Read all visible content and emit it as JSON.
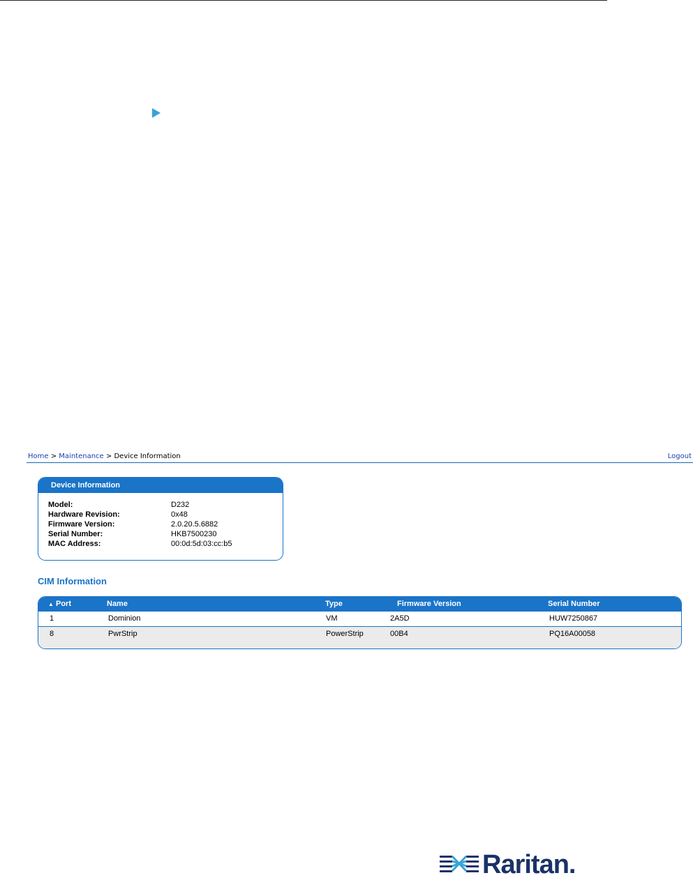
{
  "breadcrumb": {
    "home": "Home",
    "separator": ">",
    "maintenance": "Maintenance",
    "current": "Device Information"
  },
  "logout": "Logout",
  "device_info": {
    "title": "Device Information",
    "rows": [
      {
        "label": "Model:",
        "value": "D232"
      },
      {
        "label": "Hardware Revision:",
        "value": "0x48"
      },
      {
        "label": "Firmware Version:",
        "value": "2.0.20.5.6882"
      },
      {
        "label": "Serial Number:",
        "value": "HKB7500230"
      },
      {
        "label": "MAC Address:",
        "value": "00:0d:5d:03:cc:b5"
      }
    ]
  },
  "cim": {
    "title": "CIM Information",
    "sort_indicator": "▲",
    "columns": [
      "Port",
      "Name",
      "Type",
      "Firmware Version",
      "Serial Number"
    ],
    "rows": [
      [
        "1",
        "Dominion",
        "VM",
        "2A5D",
        "HUW7250867"
      ],
      [
        "8",
        "PwrStrip",
        "PowerStrip",
        "00B4",
        "PQ16A00058"
      ]
    ]
  },
  "logo": {
    "text": "Raritan.",
    "icon": "raritan-logo-icon"
  },
  "icons": {
    "play": "play-triangle-icon"
  },
  "colors": {
    "accent": "#1a74c8",
    "link": "#1a3fb0",
    "row_alt": "#ebebeb",
    "logo": "#1a3268"
  }
}
